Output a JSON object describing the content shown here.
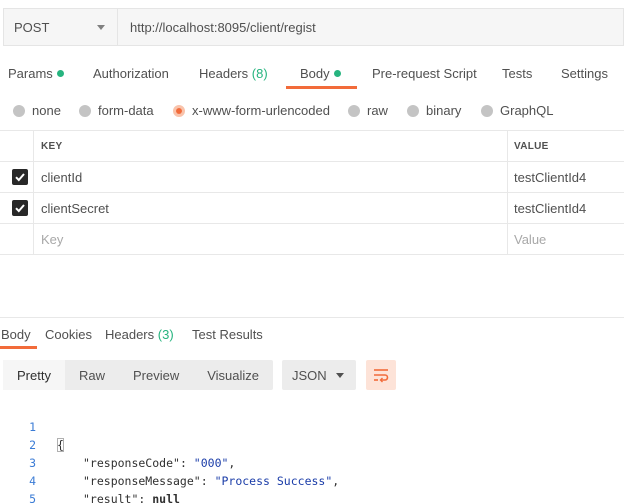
{
  "request": {
    "method": "POST",
    "url": "http://localhost:8095/client/regist"
  },
  "request_tabs": {
    "params": "Params",
    "authorization": "Authorization",
    "headers": "Headers",
    "headers_count": "(8)",
    "body": "Body",
    "pre_request": "Pre-request Script",
    "tests": "Tests",
    "settings": "Settings",
    "active": "Body"
  },
  "body_types": {
    "none": "none",
    "form_data": "form-data",
    "urlencoded": "x-www-form-urlencoded",
    "raw": "raw",
    "binary": "binary",
    "graphql": "GraphQL",
    "selected": "x-www-form-urlencoded"
  },
  "params_table": {
    "headers": {
      "key": "KEY",
      "value": "VALUE"
    },
    "rows": [
      {
        "checked": true,
        "key": "clientId",
        "value": "testClientId4"
      },
      {
        "checked": true,
        "key": "clientSecret",
        "value": "testClientId4"
      }
    ],
    "placeholder_key": "Key",
    "placeholder_value": "Value"
  },
  "response_tabs": {
    "body": "Body",
    "cookies": "Cookies",
    "headers": "Headers",
    "headers_count": "(3)",
    "test_results": "Test Results",
    "active": "Body"
  },
  "view_modes": {
    "pretty": "Pretty",
    "raw": "Raw",
    "preview": "Preview",
    "visualize": "Visualize",
    "active": "Pretty",
    "format": "JSON"
  },
  "response_body": {
    "line_numbers": [
      "1",
      "2",
      "3",
      "4",
      "5"
    ],
    "open_brace": "{",
    "close_brace": "}",
    "fields": [
      {
        "key": "\"responseCode\"",
        "sep": ": ",
        "value": "\"000\"",
        "tail": ","
      },
      {
        "key": "\"responseMessage\"",
        "sep": ": ",
        "value": "\"Process Success\"",
        "tail": ","
      },
      {
        "key": "\"result\"",
        "sep": ": ",
        "value": "null",
        "tail": ""
      }
    ]
  },
  "colors": {
    "accent": "#f26b3a",
    "success": "#26b47f",
    "line_number": "#3a7bd5"
  },
  "icons": {
    "method_dropdown": "chevron-down-icon",
    "checkbox": "checkmark-icon",
    "wrap": "wrap-lines-icon"
  }
}
